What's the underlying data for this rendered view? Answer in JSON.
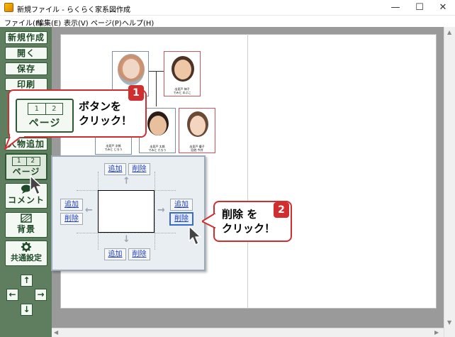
{
  "window": {
    "title": "新規ファイル - らくらく家系図作成",
    "minimize": "—",
    "maximize": "☐",
    "close": "✕"
  },
  "menu": [
    {
      "label": "ファイル(F)"
    },
    {
      "label": "編集(E)"
    },
    {
      "label": "表示(V)"
    },
    {
      "label": "ページ(P)"
    },
    {
      "label": "ヘルプ(H)"
    }
  ],
  "sidebar": {
    "new": "新規作成",
    "open": "開く",
    "save": "保存",
    "print": "印刷",
    "add_person": "人物追加",
    "page_cells": [
      "1",
      "2"
    ],
    "page": "ページ",
    "comment": "コメント",
    "background": "背景",
    "common_settings": "共通設定",
    "arrow_up": "↑",
    "arrow_left": "←",
    "arrow_right": "→",
    "arrow_down": "↓"
  },
  "tree": {
    "people": [
      {
        "name": "出見戸 伸子",
        "reading": "でみと のぶこ"
      },
      {
        "name": "出見戸 次郎",
        "reading": "でみと じろう"
      },
      {
        "name": "出見戸 太郎",
        "reading": "でみと たろう"
      },
      {
        "name": "出見戸 優子",
        "reading": "旧姓 今井"
      }
    ]
  },
  "page_popup": {
    "top_add": "追加",
    "top_delete": "削除",
    "left_add": "追加",
    "left_delete": "削除",
    "right_add": "追加",
    "right_delete": "削除",
    "bottom_add": "追加",
    "bottom_delete": "削除"
  },
  "callout1": {
    "number": "1",
    "icon_cells": [
      "1",
      "2"
    ],
    "icon_label": "ページ",
    "text": "ボタンを\nクリック！"
  },
  "callout2": {
    "number": "2",
    "text": "削除 を\nクリック！"
  },
  "colors": {
    "sidebar": "#5f7e60",
    "accent_red": "#d12e2f",
    "link_blue": "#1a3fd0"
  }
}
